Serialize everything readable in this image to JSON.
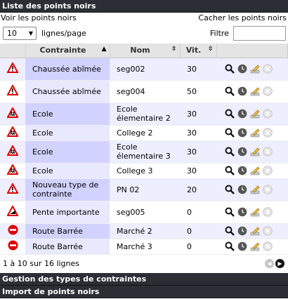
{
  "section_title": "Liste des points noirs",
  "show_link": "Voir les points noirs",
  "hide_link": "Cacher les points noirs",
  "page_size": "10",
  "page_size_label": "lignes/page",
  "filter_label": "Filtre",
  "filter_value": "",
  "columns": {
    "contrainte": "Contrainte",
    "nom": "Nom",
    "vit": "Vit."
  },
  "rows": [
    {
      "icon": "warning-icon",
      "contrainte": "Chaussée abîmée",
      "nom": "seg002",
      "vit": "30"
    },
    {
      "icon": "warning-icon",
      "contrainte": "Chaussée abîmée",
      "nom": "seg004",
      "vit": "50"
    },
    {
      "icon": "school-icon",
      "contrainte": "Ecole",
      "nom": "Ecole élementaire 2",
      "vit": "30"
    },
    {
      "icon": "school-icon",
      "contrainte": "Ecole",
      "nom": "College 2",
      "vit": "30"
    },
    {
      "icon": "school-icon",
      "contrainte": "Ecole",
      "nom": "Ecole élementaire 3",
      "vit": "30"
    },
    {
      "icon": "school-icon",
      "contrainte": "Ecole",
      "nom": "College 3",
      "vit": "30"
    },
    {
      "icon": "warning-icon",
      "contrainte": "Nouveau type de contrainte",
      "nom": "PN 02",
      "vit": "20"
    },
    {
      "icon": "slope-icon",
      "contrainte": "Pente importante",
      "nom": "seg005",
      "vit": "0"
    },
    {
      "icon": "no-entry-icon",
      "contrainte": "Route Barrée",
      "nom": "Marché 2",
      "vit": "0"
    },
    {
      "icon": "no-entry-icon",
      "contrainte": "Route Barrée",
      "nom": "Marché 3",
      "vit": "0"
    }
  ],
  "footer_info": "1 à 10 sur 16 lignes",
  "section2_title": "Gestion des types de contraintes",
  "section3_title": "Import de points noirs",
  "colors": {
    "header_bg": "#2b2f35",
    "row_highlight": "#d2d2ff"
  }
}
